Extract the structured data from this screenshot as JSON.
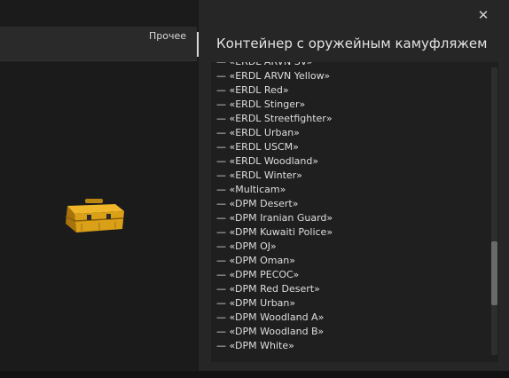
{
  "tabs": {
    "other_label": "Прочее"
  },
  "panel": {
    "title": "Контейнер с оружейным камуфляжем",
    "close_glyph": "✕"
  },
  "items": [
    "— «ERDL ARVN SV»",
    "— «ERDL ARVN Yellow»",
    "— «ERDL Red»",
    "— «ERDL Stinger»",
    "— «ERDL Streetfighter»",
    "— «ERDL Urban»",
    "— «ERDL USCM»",
    "— «ERDL Woodland»",
    "— «ERDL Winter»",
    "— «Multicam»",
    "— «DPM Desert»",
    "— «DPM Iranian Guard»",
    "— «DPM Kuwaiti Police»",
    "— «DPM OJ»",
    "— «DPM Oman»",
    "— «DPM PECOC»",
    "— «DPM Red Desert»",
    "— «DPM Urban»",
    "— «DPM Woodland A»",
    "— «DPM Woodland B»",
    "— «DPM White»"
  ],
  "icons": {
    "item": "weapon-camo-case-icon",
    "close": "close-icon"
  },
  "colors": {
    "case_body": "#d9a018",
    "case_dark": "#a8720c"
  }
}
